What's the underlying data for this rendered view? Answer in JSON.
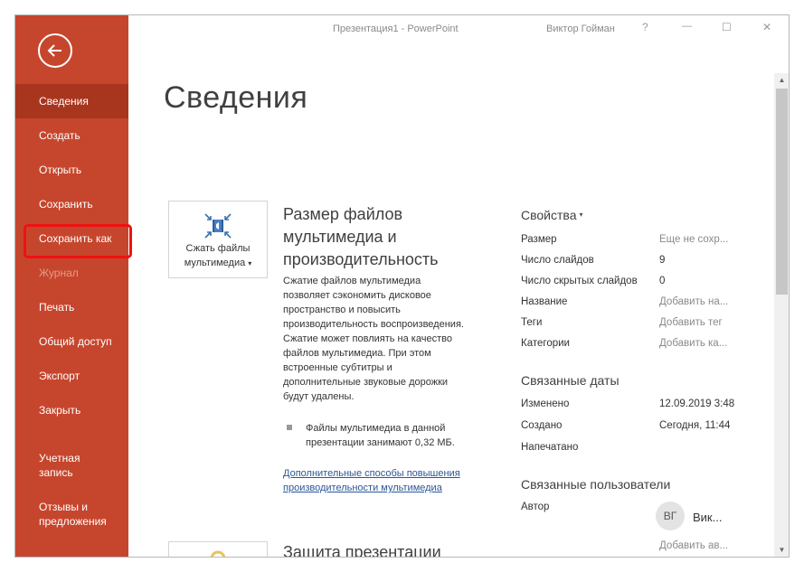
{
  "titlebar": {
    "title": "Презентация1  -  PowerPoint",
    "user": "Виктор Гойман",
    "help": "?",
    "minimize": "—",
    "maximize": "☐",
    "close": "✕"
  },
  "sidebar": {
    "items": [
      {
        "label": "Сведения"
      },
      {
        "label": "Создать"
      },
      {
        "label": "Открыть"
      },
      {
        "label": "Сохранить"
      },
      {
        "label": "Сохранить как"
      },
      {
        "label": "Журнал"
      },
      {
        "label": "Печать"
      },
      {
        "label": "Общий доступ"
      },
      {
        "label": "Экспорт"
      },
      {
        "label": "Закрыть"
      }
    ],
    "account": {
      "line1": "Учетная",
      "line2": "запись"
    },
    "feedback": {
      "line1": "Отзывы и",
      "line2": "предложения"
    },
    "accent": "#c6462d"
  },
  "main": {
    "title": "Сведения",
    "compress": {
      "card_line1": "Сжать файлы",
      "card_line2": "мультимедиа",
      "card_caret": "▾",
      "title": "Размер файлов мультимедиа и производительность",
      "description": "Сжатие файлов мультимедиа позволяет сэкономить дисковое пространство и повысить производительность воспроизведения. Сжатие может повлиять на качество файлов мультимедиа. При этом встроенные субтитры и дополнительные звуковые дорожки будут удалены.",
      "bullet": "Файлы мультимедиа в данной презентации занимают 0,32 МБ.",
      "link": "Дополнительные способы повышения производительности мультимедиа"
    },
    "protect": {
      "title": "Защита презентации"
    }
  },
  "properties": {
    "header": "Свойства",
    "caret": "▾",
    "rows": [
      {
        "key": "Размер",
        "value": "Еще не сохр..."
      },
      {
        "key": "Число слайдов",
        "value": "9"
      },
      {
        "key": "Число скрытых слайдов",
        "value": "0"
      },
      {
        "key": "Название",
        "value": "Добавить на..."
      },
      {
        "key": "Теги",
        "value": "Добавить тег"
      },
      {
        "key": "Категории",
        "value": "Добавить ка..."
      }
    ],
    "dates_header": "Связанные даты",
    "dates": [
      {
        "key": "Изменено",
        "value": "12.09.2019 3:48"
      },
      {
        "key": "Создано",
        "value": "Сегодня, 11:44"
      },
      {
        "key": "Напечатано",
        "value": ""
      }
    ],
    "users_header": "Связанные пользователи",
    "author_key": "Автор",
    "author_initials": "ВГ",
    "author_name": "Вик...",
    "add_author": "Добавить ав..."
  }
}
